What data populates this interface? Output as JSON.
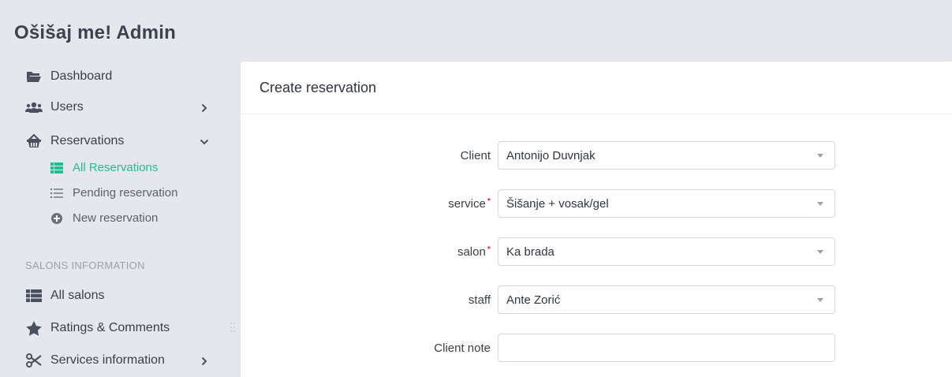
{
  "app": {
    "title": "Ošišaj me! Admin"
  },
  "sidebar": {
    "items": [
      {
        "label": "Dashboard",
        "icon": "folder-open-icon"
      },
      {
        "label": "Users",
        "icon": "users-icon",
        "chevron": "chevron-right"
      },
      {
        "label": "Reservations",
        "icon": "basket-icon",
        "chevron": "chevron-down"
      }
    ],
    "reservations_sub": [
      {
        "label": "All Reservations",
        "icon": "table-icon",
        "active": true
      },
      {
        "label": "Pending reservation",
        "icon": "list-icon"
      },
      {
        "label": "New reservation",
        "icon": "plus-circle-icon"
      }
    ],
    "section_header": "SALONS INFORMATION",
    "section_items": [
      {
        "label": "All salons",
        "icon": "table-icon"
      },
      {
        "label": "Ratings & Comments",
        "icon": "star-icon"
      },
      {
        "label": "Services information",
        "icon": "scissors-icon",
        "chevron": "chevron-right"
      }
    ]
  },
  "main": {
    "card_title": "Create reservation",
    "form": {
      "client": {
        "label": "Client",
        "value": "Antonijo Duvnjak",
        "required": false
      },
      "service": {
        "label": "service",
        "value": "Šišanje + vosak/gel",
        "required": true
      },
      "salon": {
        "label": "salon",
        "value": "Ka brada",
        "required": true
      },
      "staff": {
        "label": "staff",
        "value": "Ante Zorić",
        "required": false
      },
      "client_note": {
        "label": "Client note",
        "value": "",
        "required": false
      }
    }
  },
  "colors": {
    "accent": "#1fbf8f",
    "required": "#e8325a",
    "background": "#e5e7ec"
  }
}
